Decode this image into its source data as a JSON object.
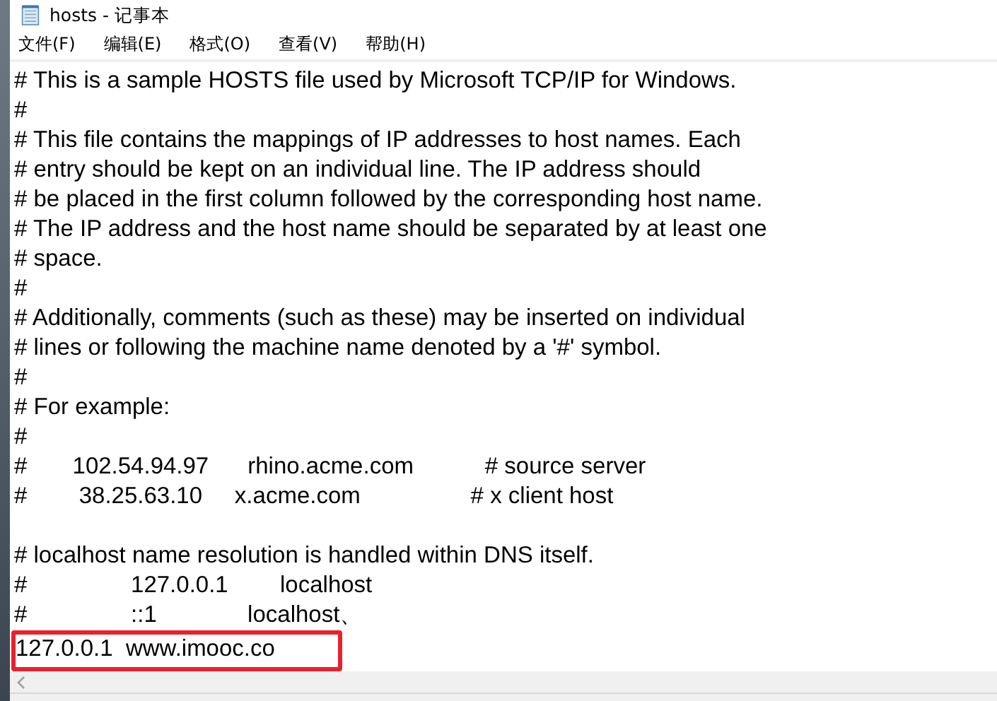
{
  "window": {
    "title": "hosts - 记事本"
  },
  "menu": [
    "文件(F)",
    "编辑(E)",
    "格式(O)",
    "查看(V)",
    "帮助(H)"
  ],
  "lines": [
    {
      "kind": "text",
      "text": "# This is a sample HOSTS file used by Microsoft TCP/IP for Windows."
    },
    {
      "kind": "text",
      "text": "#"
    },
    {
      "kind": "text",
      "text": "# This file contains the mappings of IP addresses to host names. Each"
    },
    {
      "kind": "text",
      "text": "# entry should be kept on an individual line. The IP address should"
    },
    {
      "kind": "text",
      "text": "# be placed in the first column followed by the corresponding host name."
    },
    {
      "kind": "text",
      "text": "# The IP address and the host name should be separated by at least one"
    },
    {
      "kind": "text",
      "text": "# space."
    },
    {
      "kind": "text",
      "text": "#"
    },
    {
      "kind": "text",
      "text": "# Additionally, comments (such as these) may be inserted on individual"
    },
    {
      "kind": "text",
      "text": "# lines or following the machine name denoted by a '#' symbol."
    },
    {
      "kind": "text",
      "text": "#"
    },
    {
      "kind": "text",
      "text": "# For example:"
    },
    {
      "kind": "text",
      "text": "#"
    },
    {
      "kind": "text",
      "text": "#       102.54.94.97      rhino.acme.com           # source server"
    },
    {
      "kind": "text",
      "text": "#        38.25.63.10     x.acme.com                 # x client host"
    },
    {
      "kind": "blank"
    },
    {
      "kind": "text",
      "text": "# localhost name resolution is handled within DNS itself."
    },
    {
      "kind": "text",
      "text": "#                127.0.0.1        localhost"
    },
    {
      "kind": "text",
      "text": "#                ::1              localhost、"
    },
    {
      "kind": "highlighted",
      "text": "127.0.0.1  www.imooc.co"
    }
  ]
}
